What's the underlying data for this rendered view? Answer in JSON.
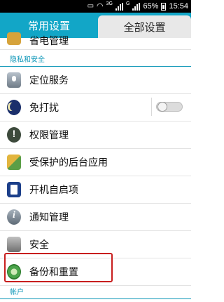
{
  "status_bar": {
    "network": "3G",
    "network2": "G",
    "battery": "65%",
    "time": "15:54"
  },
  "tabs": [
    {
      "label": "常用设置",
      "active": false
    },
    {
      "label": "全部设置",
      "active": true
    }
  ],
  "partial_item": {
    "label": "省电管理"
  },
  "section_privacy": "隐私和安全",
  "items": [
    {
      "label": "定位服务",
      "icon": "location-icon"
    },
    {
      "label": "免打扰",
      "icon": "moon-icon",
      "toggle": "off"
    },
    {
      "label": "权限管理",
      "icon": "permission-icon"
    },
    {
      "label": "受保护的后台应用",
      "icon": "protected-apps-icon"
    },
    {
      "label": "开机自启项",
      "icon": "startup-icon"
    },
    {
      "label": "通知管理",
      "icon": "info-icon"
    },
    {
      "label": "安全",
      "icon": "security-icon"
    },
    {
      "label": "备份和重置",
      "icon": "backup-icon"
    }
  ],
  "section_accounts": "帐户",
  "colors": {
    "accent": "#12a6c7",
    "highlight": "#c81e1e"
  }
}
